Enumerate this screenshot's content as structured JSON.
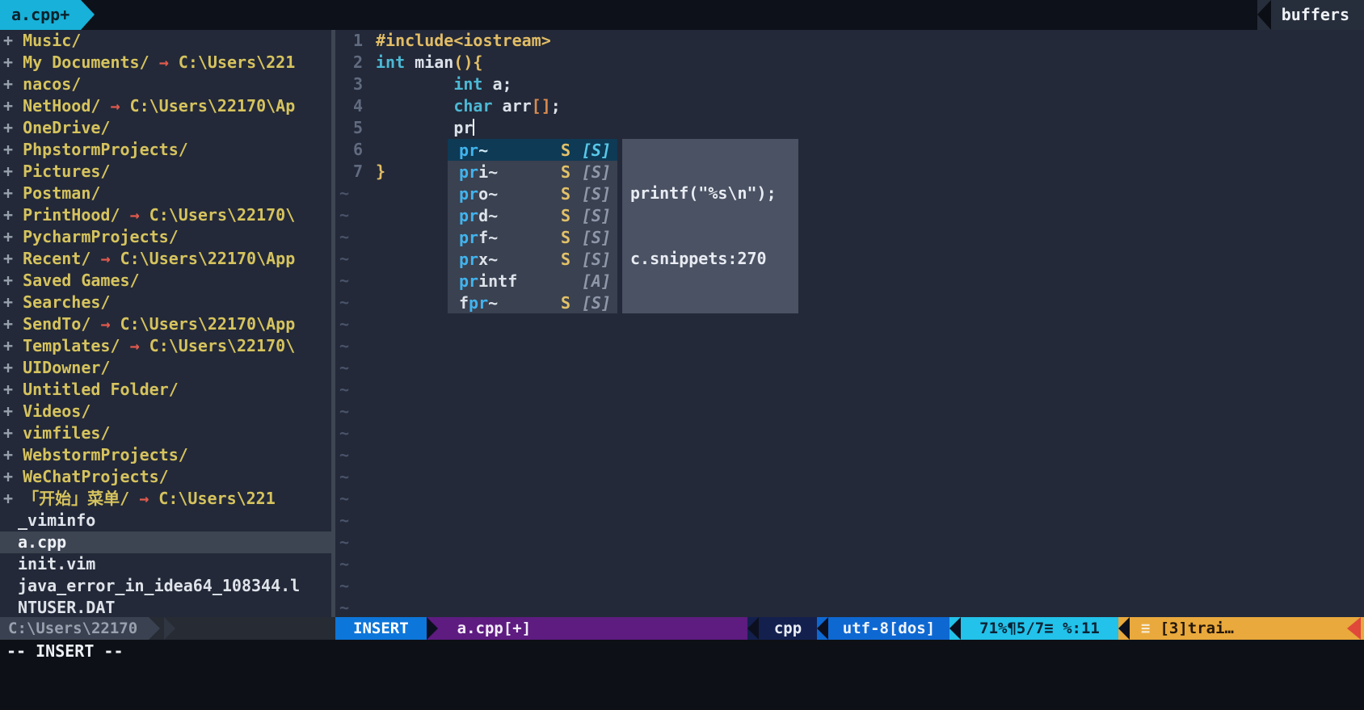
{
  "colors": {
    "tab_active_bg": "#17b1d9",
    "dir": "#d6c35e",
    "arrow": "#e05a4e",
    "file": "#dfe3ea",
    "keyword": "#4cb8d4",
    "yellow": "#e2bd66",
    "orange": "#d98a50",
    "popup_match": "#41b4ee",
    "mode_bg": "#0d76da",
    "file_seg_bg": "#5e1b80",
    "ft_seg_bg": "#13204e",
    "enc_seg_bg": "#0e68d2",
    "pos_seg_bg": "#22c2ea",
    "warn_seg_bg": "#e9a93c",
    "alert_red": "#e0483a"
  },
  "tabline": {
    "active_tab": "a.cpp+",
    "right_label": "buffers"
  },
  "sidebar": {
    "status_path": "C:\\Users\\22170",
    "items": [
      {
        "kind": "dir",
        "prefix": "+",
        "label": "Music/"
      },
      {
        "kind": "dir",
        "prefix": "+",
        "label": "My Documents/",
        "arrow": "→",
        "target": "C:\\Users\\221"
      },
      {
        "kind": "dir",
        "prefix": "+",
        "label": "nacos/"
      },
      {
        "kind": "dir",
        "prefix": "+",
        "label": "NetHood/",
        "arrow": "→",
        "target": "C:\\Users\\22170\\Ap"
      },
      {
        "kind": "dir",
        "prefix": "+",
        "label": "OneDrive/"
      },
      {
        "kind": "dir",
        "prefix": "+",
        "label": "PhpstormProjects/"
      },
      {
        "kind": "dir",
        "prefix": "+",
        "label": "Pictures/"
      },
      {
        "kind": "dir",
        "prefix": "+",
        "label": "Postman/"
      },
      {
        "kind": "dir",
        "prefix": "+",
        "label": "PrintHood/",
        "arrow": "→",
        "target": "C:\\Users\\22170\\"
      },
      {
        "kind": "dir",
        "prefix": "+",
        "label": "PycharmProjects/"
      },
      {
        "kind": "dir",
        "prefix": "+",
        "label": "Recent/",
        "arrow": "→",
        "target": "C:\\Users\\22170\\App"
      },
      {
        "kind": "dir",
        "prefix": "+",
        "label": "Saved Games/"
      },
      {
        "kind": "dir",
        "prefix": "+",
        "label": "Searches/"
      },
      {
        "kind": "dir",
        "prefix": "+",
        "label": "SendTo/",
        "arrow": "→",
        "target": "C:\\Users\\22170\\App"
      },
      {
        "kind": "dir",
        "prefix": "+",
        "label": "Templates/",
        "arrow": "→",
        "target": "C:\\Users\\22170\\"
      },
      {
        "kind": "dir",
        "prefix": "+",
        "label": "UIDowner/"
      },
      {
        "kind": "dir",
        "prefix": "+",
        "label": "Untitled Folder/"
      },
      {
        "kind": "dir",
        "prefix": "+",
        "label": "Videos/"
      },
      {
        "kind": "dir",
        "prefix": "+",
        "label": "vimfiles/"
      },
      {
        "kind": "dir",
        "prefix": "+",
        "label": "WebstormProjects/"
      },
      {
        "kind": "dir",
        "prefix": "+",
        "label": "WeChatProjects/"
      },
      {
        "kind": "dir",
        "prefix": "+",
        "label": "「开始」菜单/",
        "arrow": "→",
        "target": "C:\\Users\\221"
      },
      {
        "kind": "file",
        "label": "_viminfo"
      },
      {
        "kind": "file",
        "label": "a.cpp",
        "selected": true
      },
      {
        "kind": "file",
        "label": "init.vim"
      },
      {
        "kind": "file",
        "label": "java_error_in_idea64_108344.l"
      },
      {
        "kind": "file",
        "label": "NTUSER.DAT"
      }
    ]
  },
  "editor": {
    "lines": [
      {
        "num": "1",
        "tokens": [
          {
            "t": "#include<iostream>",
            "c": "yellow"
          }
        ]
      },
      {
        "num": "2",
        "tokens": [
          {
            "t": "int",
            "c": "keyword"
          },
          {
            "t": " mian",
            "c": "plain"
          },
          {
            "t": "(){",
            "c": "yellow"
          }
        ]
      },
      {
        "num": "3",
        "tokens": [
          {
            "t": "        ",
            "c": "plain"
          },
          {
            "t": "int",
            "c": "keyword"
          },
          {
            "t": " a;",
            "c": "plain"
          }
        ]
      },
      {
        "num": "4",
        "tokens": [
          {
            "t": "        ",
            "c": "plain"
          },
          {
            "t": "char",
            "c": "keyword"
          },
          {
            "t": " arr",
            "c": "plain"
          },
          {
            "t": "[]",
            "c": "orange"
          },
          {
            "t": ";",
            "c": "plain"
          }
        ]
      },
      {
        "num": "5",
        "tokens": [
          {
            "t": "        pr",
            "c": "plain"
          }
        ],
        "cursor": true
      },
      {
        "num": "6",
        "tokens": []
      },
      {
        "num": "7",
        "tokens": [
          {
            "t": "}",
            "c": "yellow"
          }
        ]
      }
    ],
    "empty_line_marker": "~",
    "empty_line_count": 20
  },
  "popup": {
    "items": [
      {
        "pre": "",
        "match": "pr",
        "rest": "~",
        "kind": "S",
        "src": "[S]",
        "selected": true
      },
      {
        "pre": "",
        "match": "pr",
        "rest": "i~",
        "kind": "S",
        "src": "[S]"
      },
      {
        "pre": "",
        "match": "pr",
        "rest": "o~",
        "kind": "S",
        "src": "[S]"
      },
      {
        "pre": "",
        "match": "pr",
        "rest": "d~",
        "kind": "S",
        "src": "[S]"
      },
      {
        "pre": "",
        "match": "pr",
        "rest": "f~",
        "kind": "S",
        "src": "[S]"
      },
      {
        "pre": "",
        "match": "pr",
        "rest": "x~",
        "kind": "S",
        "src": "[S]"
      },
      {
        "pre": "",
        "match": "pr",
        "rest": "intf",
        "kind": "",
        "src": "[A]"
      },
      {
        "pre": "f",
        "match": "pr",
        "rest": "~",
        "kind": "S",
        "src": "[S]"
      }
    ],
    "preview": {
      "line1": "printf(\"%s\\n\");",
      "line2": "c.snippets:270"
    }
  },
  "statusline": {
    "mode": "INSERT",
    "file": "a.cpp[+]",
    "filetype": "cpp",
    "encoding": "utf-8[dos]",
    "position": "71%¶5/7≡ %:11",
    "warning_icon": "≡",
    "warning": "[3]trai…"
  },
  "cmdline": {
    "text": "-- INSERT --"
  }
}
